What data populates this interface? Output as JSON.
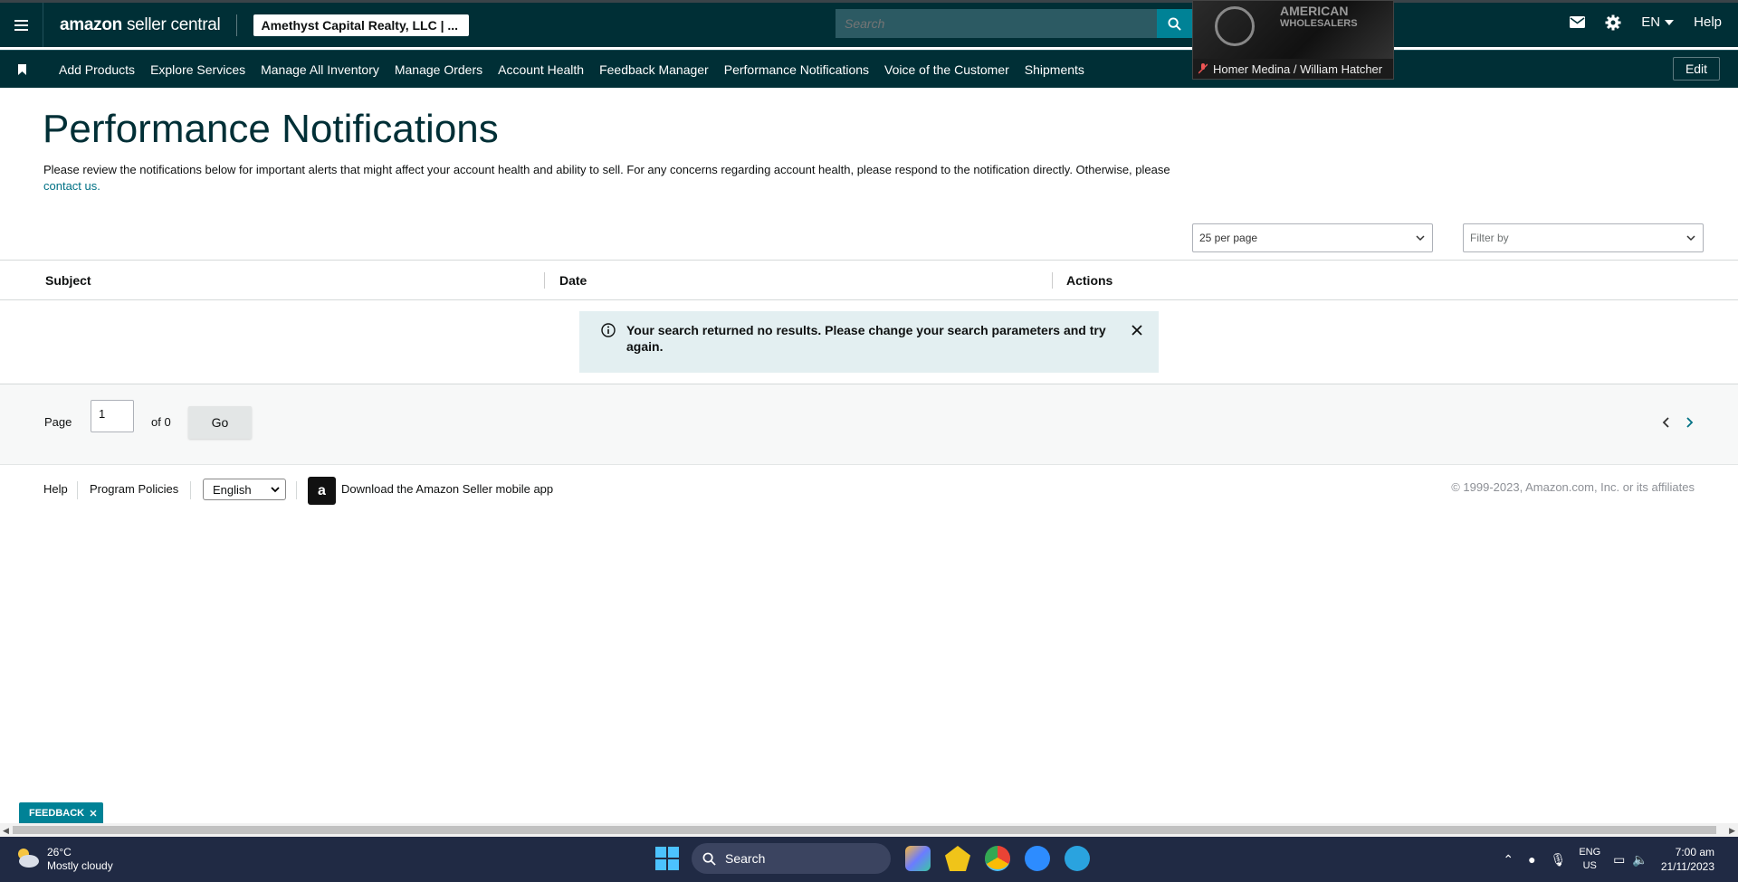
{
  "header": {
    "logo_main": "amazon",
    "logo_sub": "seller central",
    "account": "Amethyst Capital Realty, LLC | ...",
    "search_placeholder": "Search",
    "language": "EN",
    "help": "Help"
  },
  "video": {
    "overlay_text": "AMERICAN",
    "overlay_text2": "WHOLESALERS",
    "participant": "Homer Medina / William Hatcher"
  },
  "nav": {
    "items": [
      "Add Products",
      "Explore Services",
      "Manage All Inventory",
      "Manage Orders",
      "Account Health",
      "Feedback Manager",
      "Performance Notifications",
      "Voice of the Customer",
      "Shipments"
    ],
    "edit": "Edit"
  },
  "main": {
    "title": "Performance Notifications",
    "description": "Please review the notifications below for important alerts that might affect your account health and ability to sell. For any concerns regarding account health, please respond to the notification directly. Otherwise, please",
    "contact_link": "contact us.",
    "per_page": "25 per page",
    "filter_placeholder": "Filter by"
  },
  "table": {
    "columns": [
      "Subject",
      "Date",
      "Actions"
    ],
    "empty_message": "Your search returned no results. Please change your search parameters and try again."
  },
  "pager": {
    "page_label": "Page",
    "page_value": "1",
    "of_label": "of 0",
    "go": "Go"
  },
  "footer": {
    "help": "Help",
    "program_policies": "Program Policies",
    "language": "English",
    "app_icon_letter": "a",
    "download_app": "Download the Amazon Seller mobile app",
    "copyright": "© 1999-2023, Amazon.com, Inc. or its affiliates"
  },
  "feedback_tab": "FEEDBACK",
  "taskbar": {
    "temperature": "26°C",
    "weather": "Mostly cloudy",
    "search": "Search",
    "lang_top": "ENG",
    "lang_bottom": "US",
    "time": "7:00 am",
    "date": "21/11/2023"
  },
  "colors": {
    "header_bg": "#002f36",
    "accent": "#008296",
    "link": "#007185",
    "alert_bg": "#e3eff1",
    "taskbar_bg": "#202a44"
  }
}
